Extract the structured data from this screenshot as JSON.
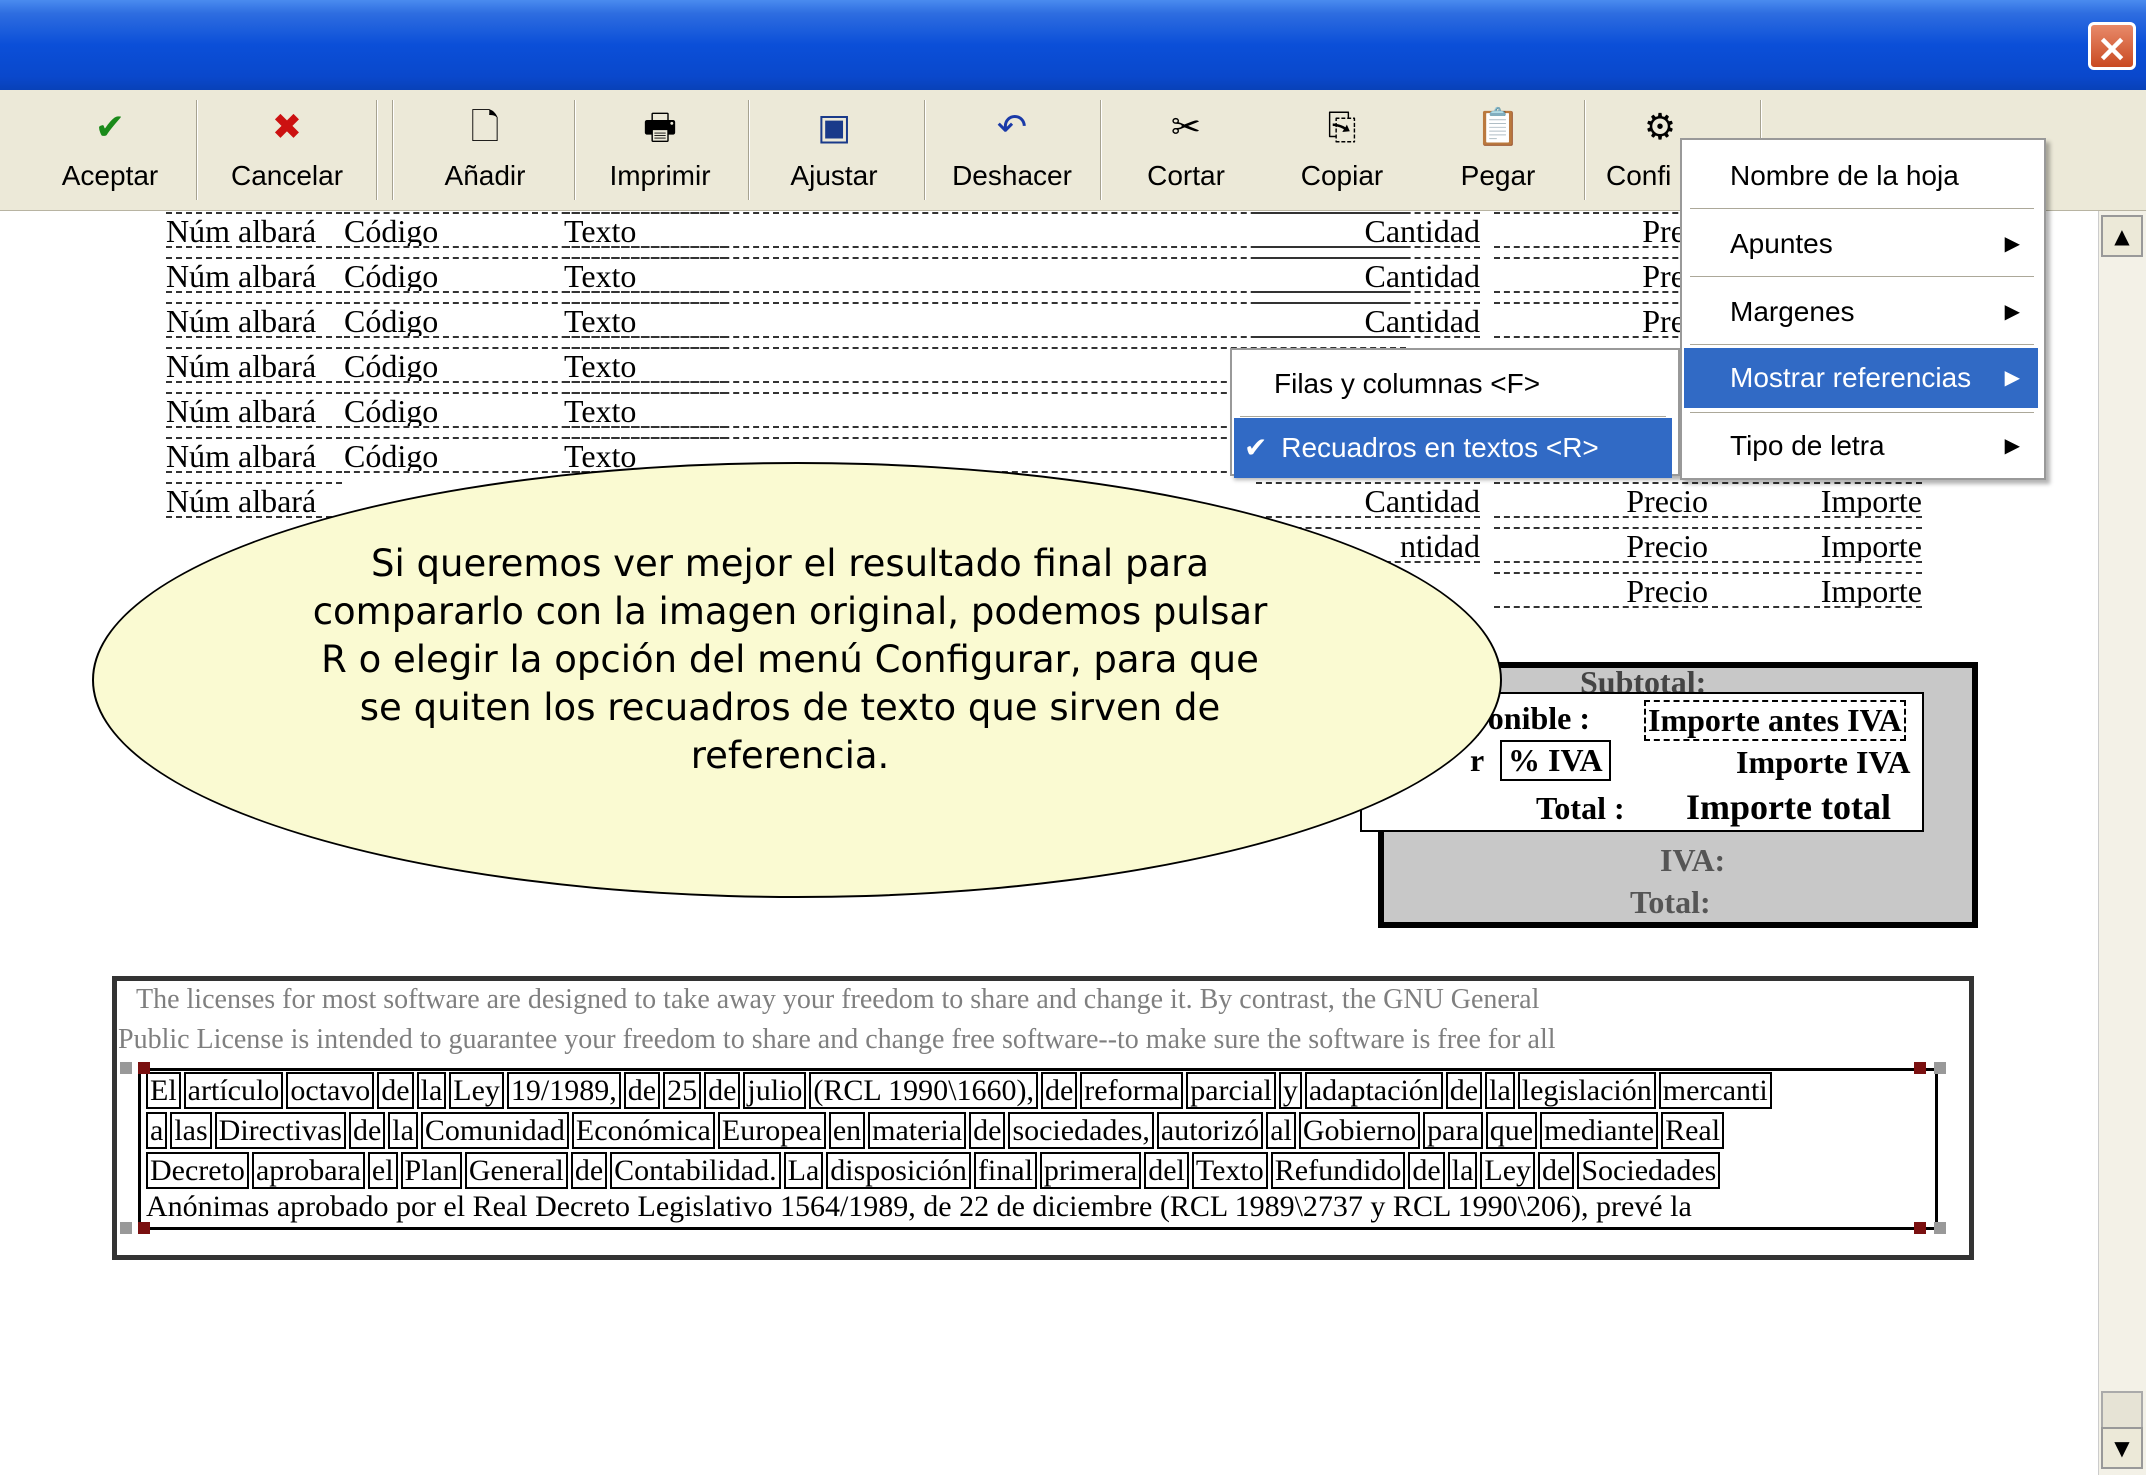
{
  "window": {
    "close_label": "×"
  },
  "toolbar": {
    "buttons": [
      {
        "label": "Aceptar",
        "icon": "✔"
      },
      {
        "label": "Cancelar",
        "icon": "✖"
      },
      {
        "label": "Añadir",
        "icon": "🗋"
      },
      {
        "label": "Imprimir",
        "icon": "🖶"
      },
      {
        "label": "Ajustar",
        "icon": "▣"
      },
      {
        "label": "Deshacer",
        "icon": "↶"
      },
      {
        "label": "Cortar",
        "icon": "✂"
      },
      {
        "label": "Copiar",
        "icon": "⎘"
      },
      {
        "label": "Pegar",
        "icon": "📋"
      },
      {
        "label": "Confi",
        "icon": "⚙"
      }
    ]
  },
  "table": {
    "rows": [
      {
        "c1": "Núm albará",
        "c2": "Código",
        "c3": "Texto",
        "c4": "Cantidad",
        "c5": "Preci",
        "c6": ""
      },
      {
        "c1": "Núm albará",
        "c2": "Código",
        "c3": "Texto",
        "c4": "Cantidad",
        "c5": "Preci",
        "c6": ""
      },
      {
        "c1": "Núm albará",
        "c2": "Código",
        "c3": "Texto",
        "c4": "Cantidad",
        "c5": "Preci",
        "c6": ""
      },
      {
        "c1": "Núm albará",
        "c2": "Código",
        "c3": "Texto",
        "c4": "",
        "c5": "",
        "c6": ""
      },
      {
        "c1": "Núm albará",
        "c2": "Código",
        "c3": "Texto",
        "c4": "",
        "c5": "",
        "c6": ""
      },
      {
        "c1": "Núm albará",
        "c2": "Código",
        "c3": "Texto",
        "c4": "",
        "c5": "",
        "c6": ""
      },
      {
        "c1": "Núm albará",
        "c2": "",
        "c3": "",
        "c4": "Cantidad",
        "c5": "Precio",
        "c6": "Importe"
      },
      {
        "c1": "",
        "c2": "",
        "c3": "",
        "c4": "ntidad",
        "c5": "Precio",
        "c6": "Importe"
      },
      {
        "c1": "",
        "c2": "",
        "c3": "",
        "c4": "",
        "c5": "Precio",
        "c6": "Importe"
      }
    ]
  },
  "totals": {
    "subtotal_label": "Subtotal:",
    "base_label": "ponible :",
    "base_value": "Importe antes IVA",
    "pct_partial": "r",
    "pct_label": "% IVA",
    "iva_value": "Importe IVA",
    "total_label": "Total :",
    "total_value": "Importe total",
    "iva_label": "IVA:",
    "total2_label": "Total:"
  },
  "balloon": {
    "text": "Si queremos ver mejor el resultado final para compararlo con la imagen original, podemos pulsar R o elegir la opción del menú Configurar, para que se quiten los recuadros de texto que sirven de referencia."
  },
  "license": {
    "line1": "The licenses for most software are designed to take away your freedom to share and change it.  By contrast, the GNU General",
    "line2": "Public License is intended to guarantee your freedom to share and change free software--to make sure the software is free for all",
    "lines": [
      [
        "El",
        "artículo",
        "octavo",
        "de",
        "la",
        "Ley",
        "19/1989,",
        "de",
        "25",
        "de",
        "julio",
        "(RCL 1990\\1660),",
        "de",
        "reforma",
        "parcial",
        "y",
        "adaptación",
        "de",
        "la",
        "legislación",
        "mercanti"
      ],
      [
        "a",
        "las",
        "Directivas",
        "de",
        "la",
        "Comunidad",
        "Económica",
        "Europea",
        "en",
        "materia",
        "de",
        "sociedades,",
        "autorizó",
        "al",
        "Gobierno",
        "para",
        "que",
        "mediante",
        "Real"
      ],
      [
        "Decreto",
        "aprobara",
        "el",
        "Plan",
        "General",
        "de",
        "Contabilidad.",
        "La",
        "disposición",
        "final",
        "primera",
        "del",
        "Texto",
        "Refundido",
        "de",
        "la",
        "Ley",
        "de",
        "Sociedades"
      ]
    ],
    "last_line": "Anónimas aprobado por el Real Decreto Legislativo 1564/1989, de 22 de diciembre (RCL 1989\\2737 y RCL 1990\\206), prevé la"
  },
  "config_menu": {
    "items": [
      {
        "label": "Nombre de la hoja",
        "submenu": false
      },
      {
        "label": "Apuntes",
        "submenu": true
      },
      {
        "label": "Margenes",
        "submenu": true
      },
      {
        "label": "Mostrar referencias",
        "submenu": true,
        "highlighted": true
      },
      {
        "label": "Tipo de letra",
        "submenu": true
      }
    ]
  },
  "sub_menu": {
    "items": [
      {
        "label": "Filas y columnas <F>",
        "checked": false
      },
      {
        "label": "Recuadros en textos <R>",
        "checked": true,
        "highlighted": true
      }
    ],
    "check_mark": "✔"
  },
  "scrollbar": {
    "up": "▲",
    "down": "▼"
  },
  "colors": {
    "titlebar": "#0A48CC",
    "menu_highlight": "#316AC5",
    "balloon": "#FAFAD2",
    "toolbar": "#ECE9D8"
  }
}
